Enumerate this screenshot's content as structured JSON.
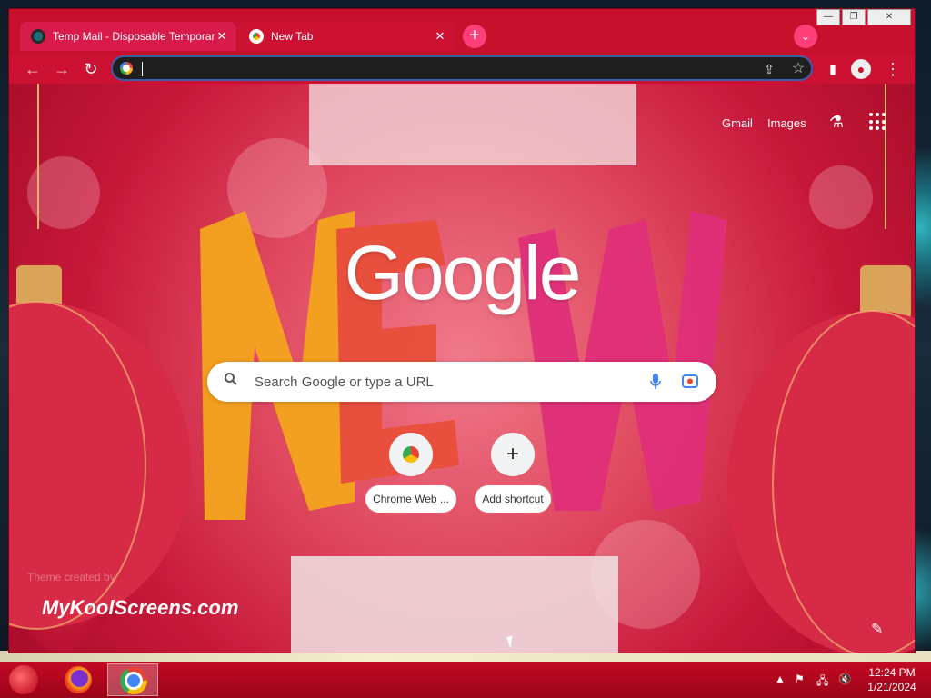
{
  "browser": {
    "tabs": [
      {
        "title": "Temp Mail - Disposable Temporary",
        "favicon": "temp-mail-icon",
        "close": "✕"
      },
      {
        "title": "New Tab",
        "favicon": "chrome-icon",
        "close": "✕"
      }
    ],
    "new_tab_glyph": "+",
    "tab_search_glyph": "⌄",
    "window_buttons": {
      "minimize": "—",
      "restore": "❐",
      "close": "✕"
    },
    "nav": {
      "back": "←",
      "forward": "→",
      "reload": "↻"
    },
    "omnibox": {
      "value": "",
      "share": "⇪",
      "bookmark": "☆"
    },
    "side_panel": "▮",
    "menu": "⋮"
  },
  "ntp": {
    "header_links": [
      "Gmail",
      "Images"
    ],
    "labs_glyph": "⚗",
    "logo": "Google",
    "search_placeholder": "Search Google or type a URL",
    "shortcuts": [
      {
        "label": "Chrome Web ...",
        "icon": "chrome-web-store-icon"
      },
      {
        "label": "Add shortcut",
        "icon": "plus-icon",
        "glyph": "+"
      }
    ],
    "theme_credit": "Theme created by",
    "brand_watermark": "MyKoolScreens.com",
    "customize_glyph": "✎"
  },
  "taskbar": {
    "tray_icons": [
      "▲",
      "⚑",
      "🖧",
      "🔇"
    ],
    "time": "12:24 PM",
    "date": "1/21/2024"
  },
  "colors": {
    "frame": "#c8102e",
    "accent": "#ff3f7a",
    "omnibox_bg": "#1f1f1f"
  }
}
